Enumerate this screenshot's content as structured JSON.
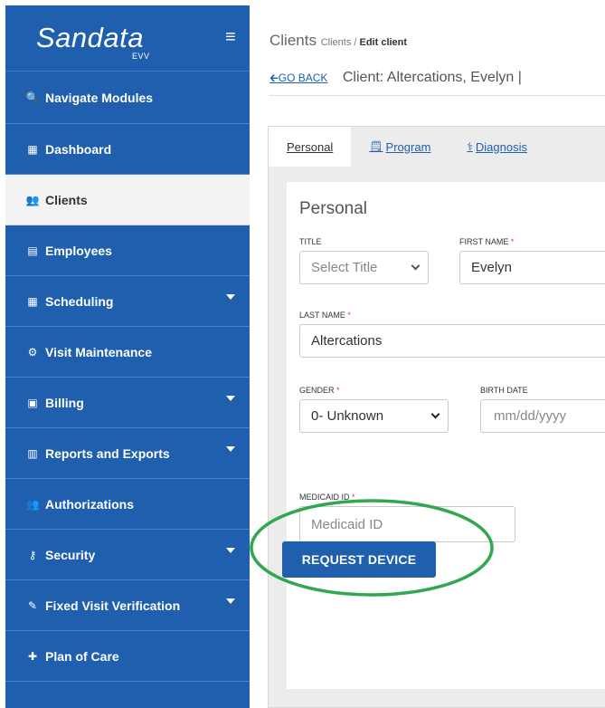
{
  "brand": {
    "logo": "Sandata",
    "sub": "EVV"
  },
  "sidebar": {
    "items": [
      {
        "icon": "search-icon",
        "glyph": "🔍",
        "label": "Navigate Modules",
        "has_caret": false,
        "active": false
      },
      {
        "icon": "dashboard-icon",
        "glyph": "▦",
        "label": "Dashboard",
        "has_caret": false,
        "active": false
      },
      {
        "icon": "users-icon",
        "glyph": "👥",
        "label": "Clients",
        "has_caret": false,
        "active": true
      },
      {
        "icon": "id-card-icon",
        "glyph": "▤",
        "label": "Employees",
        "has_caret": false,
        "active": false
      },
      {
        "icon": "calendar-icon",
        "glyph": "▦",
        "label": "Scheduling",
        "has_caret": true,
        "active": false
      },
      {
        "icon": "cogs-icon",
        "glyph": "⚙",
        "label": "Visit Maintenance",
        "has_caret": false,
        "active": false
      },
      {
        "icon": "money-icon",
        "glyph": "▣",
        "label": "Billing",
        "has_caret": true,
        "active": false
      },
      {
        "icon": "bar-chart-icon",
        "glyph": "▥",
        "label": "Reports and Exports",
        "has_caret": true,
        "active": false
      },
      {
        "icon": "users-icon",
        "glyph": "👥",
        "label": "Authorizations",
        "has_caret": false,
        "active": false
      },
      {
        "icon": "key-icon",
        "glyph": "⚷",
        "label": "Security",
        "has_caret": true,
        "active": false
      },
      {
        "icon": "edit-icon",
        "glyph": "✎",
        "label": "Fixed Visit Verification",
        "has_caret": true,
        "active": false
      },
      {
        "icon": "medkit-icon",
        "glyph": "✚",
        "label": "Plan of Care",
        "has_caret": false,
        "active": false
      }
    ]
  },
  "header": {
    "section": "Clients",
    "crumb_parent": "Clients",
    "crumb_sep": " / ",
    "crumb_current": "Edit client",
    "go_back": "GO BACK",
    "client_title": "Client: Altercations, Evelyn |"
  },
  "tabs": [
    {
      "label": "Personal",
      "icon": "",
      "active": true
    },
    {
      "label": "Program",
      "icon": "calendar-icon",
      "active": false
    },
    {
      "label": "Diagnosis",
      "icon": "stethoscope-icon",
      "active": false
    }
  ],
  "form": {
    "section_title": "Personal",
    "title_label": "TITLE",
    "title_value": "Select Title",
    "first_name_label": "FIRST NAME",
    "first_name_value": "Evelyn",
    "last_name_label": "LAST NAME",
    "last_name_value": "Altercations",
    "gender_label": "GENDER",
    "gender_value": "0- Unknown",
    "birth_date_label": "BIRTH DATE",
    "birth_date_placeholder": "mm/dd/yyyy",
    "medicaid_label": "MEDICAID ID",
    "medicaid_placeholder": "Medicaid ID",
    "required_mark": "*",
    "request_button": "REQUEST DEVICE"
  },
  "colors": {
    "primary": "#1f5fae",
    "highlight_circle": "#2fa84f",
    "required": "#e53935"
  }
}
